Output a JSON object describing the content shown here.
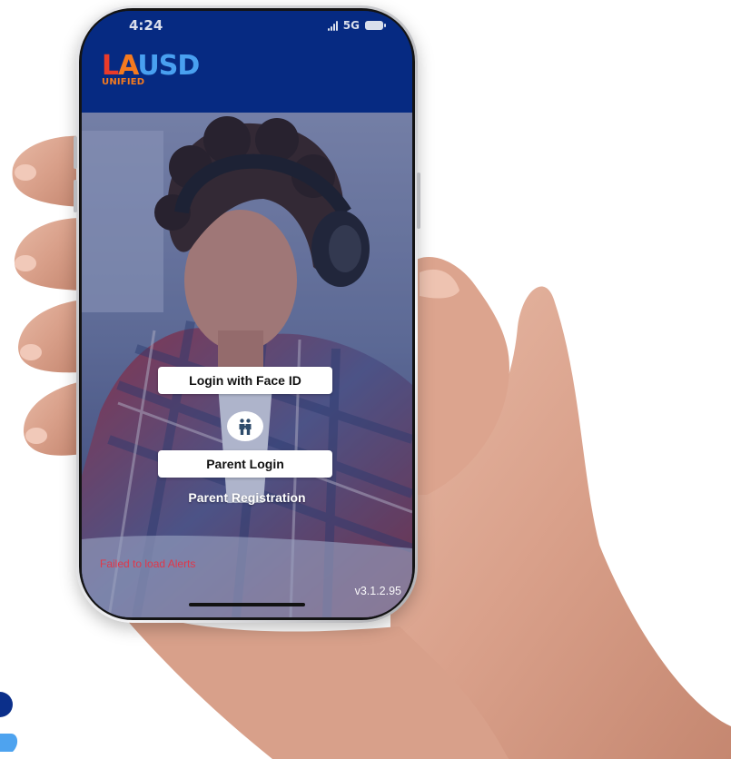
{
  "status_bar": {
    "time": "4:24",
    "network": "5G",
    "signal_icon": "signal-bars-icon",
    "battery_icon": "battery-icon"
  },
  "header": {
    "logo": {
      "letters": [
        "L",
        "A",
        "USD"
      ],
      "subtitle": "UNIFIED"
    },
    "background_color": "#062a82"
  },
  "main": {
    "face_id_button": "Login with Face ID",
    "parent_icon": "parent-child-icon",
    "parent_login_button": "Parent Login",
    "parent_registration_link": "Parent Registration",
    "alerts_error": "Failed to load Alerts",
    "version": "v3.1.2.95"
  },
  "colors": {
    "accent_red": "#ea3b2a",
    "accent_orange": "#f47a1f",
    "accent_blue": "#49a0f0",
    "error_red": "#e0384a"
  }
}
